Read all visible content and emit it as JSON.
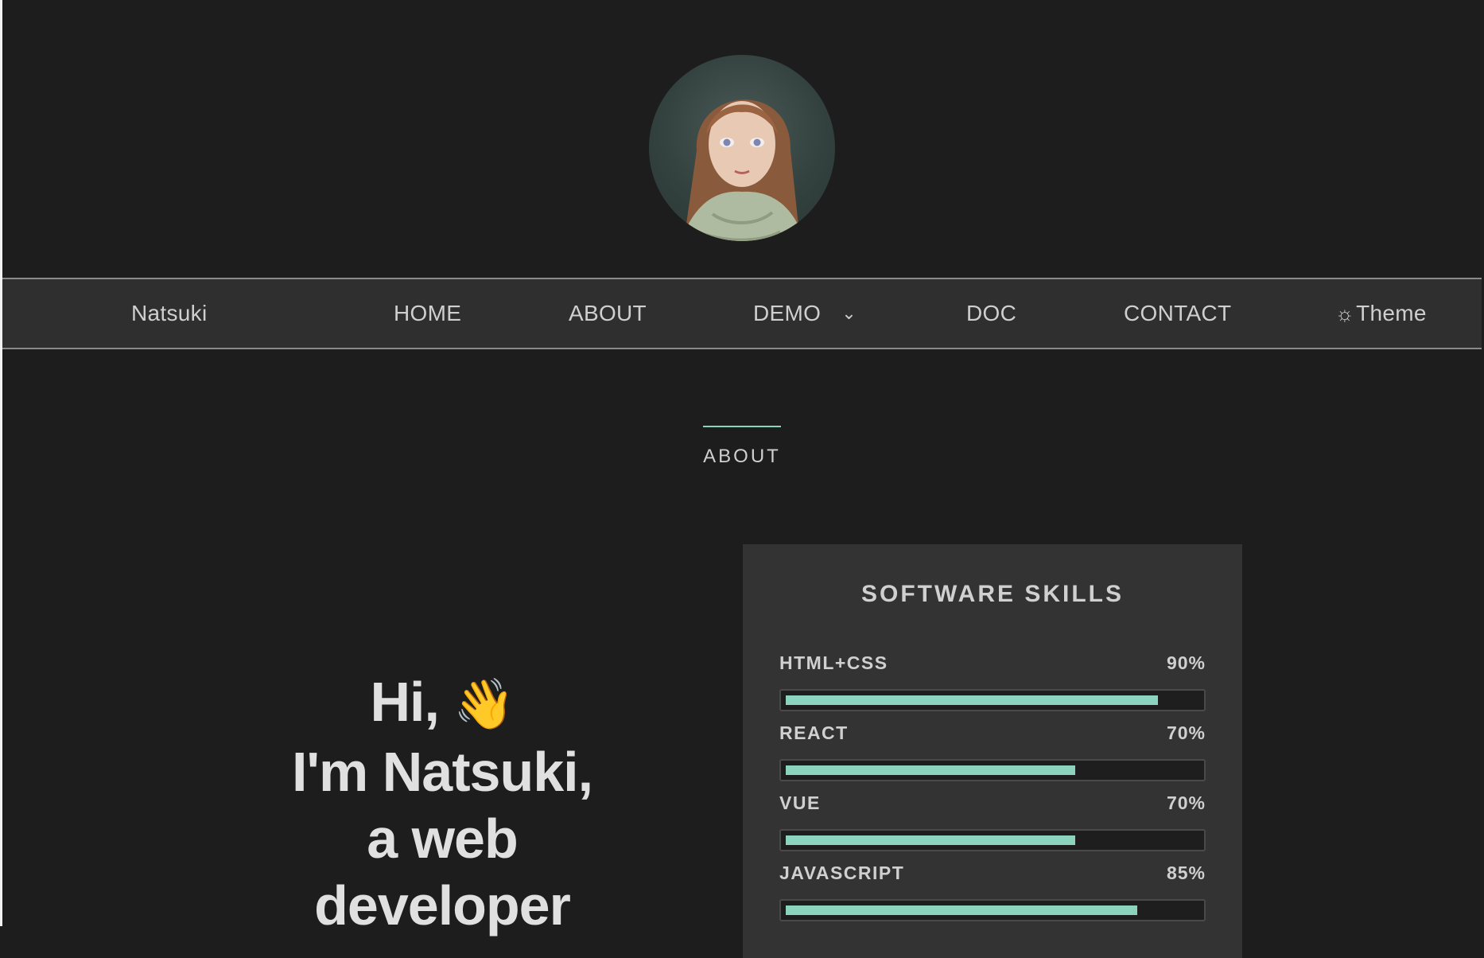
{
  "navbar": {
    "brand": "Natsuki",
    "items": [
      {
        "label": "HOME"
      },
      {
        "label": "ABOUT"
      },
      {
        "label": "DEMO"
      },
      {
        "label": "DOC"
      },
      {
        "label": "CONTACT"
      }
    ],
    "theme_label": "Theme",
    "theme_icon": "sun-icon",
    "demo_icon": "chevron-down-icon"
  },
  "section": {
    "title": "ABOUT"
  },
  "hero": {
    "line1": "Hi,",
    "wave": "👋",
    "line2": "I'm Natsuki,",
    "line3": "a web",
    "line4": "developer"
  },
  "skills": {
    "title": "SOFTWARE SKILLS",
    "items": [
      {
        "name": "HTML+CSS",
        "percent_label": "90%",
        "level": 0.9
      },
      {
        "name": "REACT",
        "percent_label": "70%",
        "level": 0.7
      },
      {
        "name": "VUE",
        "percent_label": "70%",
        "level": 0.7
      },
      {
        "name": "JAVASCRIPT",
        "percent_label": "85%",
        "level": 0.85
      }
    ]
  },
  "colors": {
    "background": "#1d1d1d",
    "navbar": "#2f2f2f",
    "card": "#333333",
    "accent": "#8cd3bd",
    "text": "#d6d6d6"
  }
}
